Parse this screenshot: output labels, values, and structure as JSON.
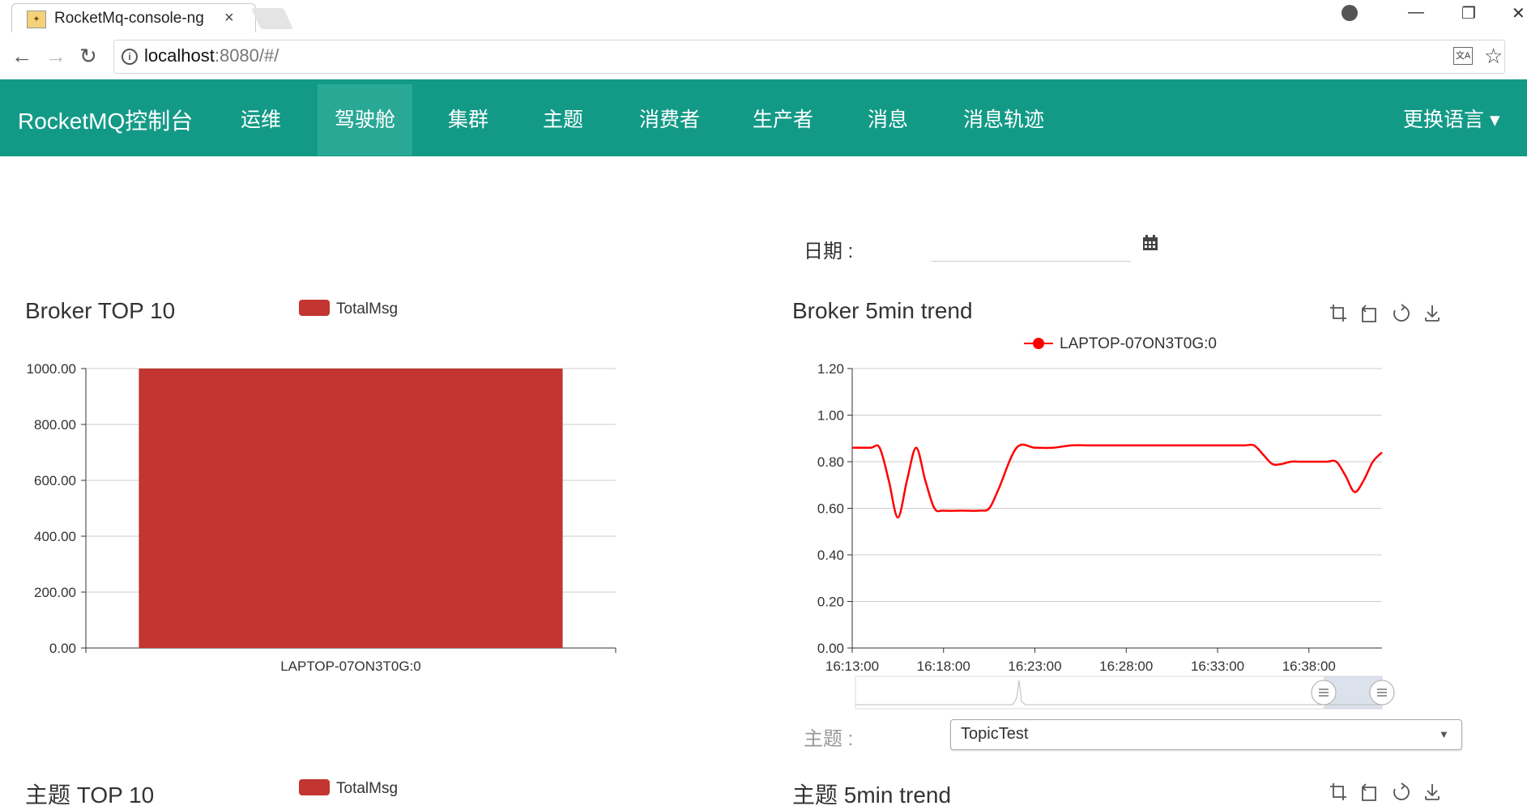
{
  "browser": {
    "tab_title": "RocketMq-console-ng",
    "tab_close": "×",
    "url_host": "localhost",
    "url_rest": ":8080/#/",
    "nav": {
      "back": "←",
      "forward": "→",
      "reload": "↻"
    },
    "window": {
      "minimize": "—",
      "restore": "❐",
      "close": "✕"
    }
  },
  "navbar": {
    "brand": "RocketMQ控制台",
    "items": [
      "运维",
      "驾驶舱",
      "集群",
      "主题",
      "消费者",
      "生产者",
      "消息",
      "消息轨迹"
    ],
    "active_index": 1,
    "language": "更换语言",
    "language_caret": "▾",
    "color": "#139a87"
  },
  "filters": {
    "date_label": "日期 :",
    "date_value": "",
    "topic_label": "主题 :",
    "topic_value": "TopicTest",
    "topic_caret": "▼"
  },
  "icons": {
    "calendar": "calendar-icon",
    "zoom": "data-zoom-icon",
    "restore": "zoom-restore-icon",
    "refresh": "refresh-icon",
    "download": "download-icon"
  },
  "chart_data": [
    {
      "type": "bar",
      "title": "Broker TOP 10",
      "legend": [
        "TotalMsg"
      ],
      "categories": [
        "LAPTOP-07ON3T0G:0"
      ],
      "series": [
        {
          "name": "TotalMsg",
          "values": [
            1000
          ]
        }
      ],
      "ylim": [
        0,
        1000
      ],
      "yticks": [
        "0.00",
        "200.00",
        "400.00",
        "600.00",
        "800.00",
        "1000.00"
      ],
      "color": "#c23531",
      "grid": true
    },
    {
      "type": "line",
      "title": "Broker 5min trend",
      "legend": [
        "LAPTOP-07ON3T0G:0"
      ],
      "x_minutes": [
        0,
        2,
        3,
        4,
        5,
        6,
        7,
        8,
        9,
        10,
        12,
        14,
        15,
        16,
        18,
        20,
        22,
        24,
        26,
        28,
        30,
        32,
        33,
        34,
        35,
        36,
        37,
        38,
        40,
        41,
        42,
        43,
        44,
        45,
        46,
        47,
        48,
        49,
        50,
        51,
        52,
        53,
        54,
        55,
        56,
        57,
        58
      ],
      "x_tick_labels": [
        "16:13:00",
        "16:18:00",
        "16:23:00",
        "16:28:00",
        "16:33:00",
        "16:38:00"
      ],
      "y": [
        0.86,
        0.86,
        0.86,
        0.72,
        0.56,
        0.72,
        0.86,
        0.72,
        0.6,
        0.59,
        0.59,
        0.59,
        0.6,
        0.68,
        0.86,
        0.86,
        0.86,
        0.87,
        0.87,
        0.87,
        0.87,
        0.87,
        0.87,
        0.87,
        0.87,
        0.87,
        0.87,
        0.87,
        0.87,
        0.87,
        0.87,
        0.87,
        0.87,
        0.83,
        0.79,
        0.79,
        0.8,
        0.8,
        0.8,
        0.8,
        0.8,
        0.8,
        0.74,
        0.67,
        0.72,
        0.8,
        0.84,
        0.86
      ],
      "ylim": [
        0,
        1.2
      ],
      "yticks": [
        "0.00",
        "0.20",
        "0.40",
        "0.60",
        "0.80",
        "1.00",
        "1.20"
      ],
      "color": "#ff0000",
      "grid": true,
      "datazoom": true
    },
    {
      "type": "bar",
      "title": "主题 TOP 10",
      "legend": [
        "TotalMsg"
      ],
      "color": "#c23531"
    },
    {
      "type": "line",
      "title": "主题 5min trend"
    }
  ]
}
